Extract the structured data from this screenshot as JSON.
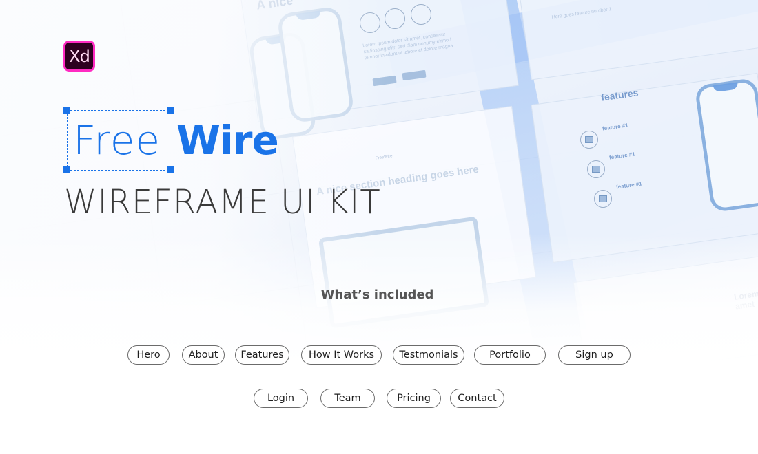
{
  "brand": {
    "app_badge": "Xd",
    "title_light": "Free",
    "title_bold": "Wire",
    "subtitle": "WIREFRAME UI KIT"
  },
  "section": {
    "heading": "What’s included"
  },
  "pages_row1": [
    {
      "label": "Hero"
    },
    {
      "label": "About"
    },
    {
      "label": "Features"
    },
    {
      "label": "How It Works"
    },
    {
      "label": "Testmonials"
    },
    {
      "label": "Portfolio"
    },
    {
      "label": "Sign up"
    }
  ],
  "pages_row2": [
    {
      "label": "Login"
    },
    {
      "label": "Team"
    },
    {
      "label": "Pricing"
    },
    {
      "label": "Contact"
    }
  ],
  "background_mockups": {
    "features_title": "features",
    "feature_label": "feature #1",
    "hero_heading": "A nice section heading goes here",
    "mini_logo": "FreeWire",
    "checklist_item": "Here goes feature number 1",
    "lorem_short": "Lorem ipsum dolor sit amet, consetetur sadipscing elitr, sed diam nonumy eirmod tempor invidunt ut labore et dolore magna",
    "lorem_heading": "Lorem amet",
    "top_heading_fragment": "A nice"
  },
  "colors": {
    "brand_blue": "#1a73e8",
    "xd_bg": "#2e001f",
    "xd_border": "#ff2bc2",
    "text_dark": "#3a3a3a"
  }
}
